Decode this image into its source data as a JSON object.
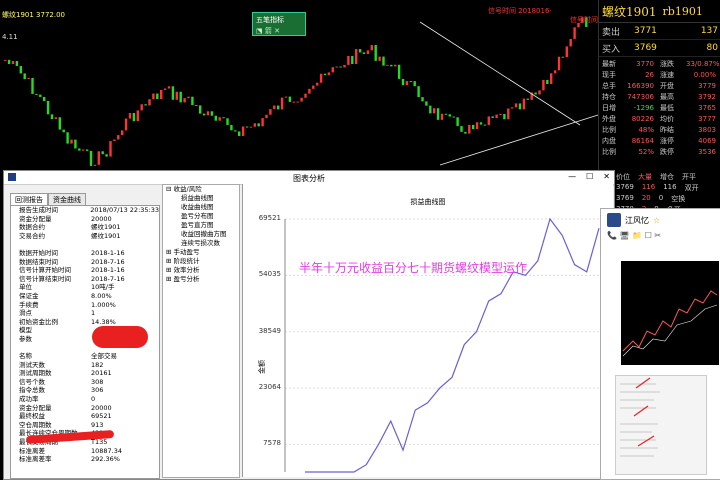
{
  "chart_top": {
    "title": "螺纹1901 3772.00",
    "price_tag": "4.11",
    "hud_title": "五笔指标",
    "hud_icons": "⬔ 箭 ✕",
    "annotation": "信号时间 2018016·",
    "annotation2": "信号时间"
  },
  "quote": {
    "name": "螺纹1901",
    "code": "rb1901",
    "sell_label": "卖出",
    "sell_price": "3771",
    "sell_vol": "137",
    "buy_label": "买入",
    "buy_price": "3769",
    "buy_vol": "80",
    "stats": [
      {
        "k": "最新",
        "v": "3770",
        "k2": "涨跌",
        "v2": "33/0.87%"
      },
      {
        "k": "现手",
        "v": "26",
        "k2": "涨速",
        "v2": "0.00%"
      },
      {
        "k": "总手",
        "v": "166390",
        "k2": "开盘",
        "v2": "3779"
      },
      {
        "k": "持仓",
        "v": "747306",
        "k2": "最高",
        "v2": "3792"
      },
      {
        "k": "日增",
        "v": "-1296",
        "k2": "最低",
        "v2": "3765"
      },
      {
        "k": "外盘",
        "v": "80226",
        "k2": "均价",
        "v2": "3777"
      },
      {
        "k": "比例",
        "v": "48%",
        "k2": "昨结",
        "v2": "3803"
      },
      {
        "k": "内盘",
        "v": "86164",
        "k2": "涨停",
        "v2": "4069"
      },
      {
        "k": "比例",
        "v": "52%",
        "k2": "跌停",
        "v2": "3536"
      }
    ],
    "tick_header": [
      "价位",
      "大量",
      "增仓",
      "开平"
    ],
    "ticks": [
      [
        "3769",
        "116",
        "116",
        "双开"
      ],
      [
        "3769",
        "20",
        "0",
        "空换"
      ],
      [
        "3770",
        "2",
        "0",
        "多开"
      ]
    ]
  },
  "window": {
    "title": "图表分析",
    "controls": [
      "—",
      "☐",
      "✕"
    ],
    "tabs": [
      "回测报告",
      "资金曲线"
    ],
    "report": [
      {
        "k": "报告生成时间",
        "v": "2018/07/13 22:35:33"
      },
      {
        "k": "资金分配量",
        "v": "20000"
      },
      {
        "k": "数据合约",
        "v": "螺纹1901"
      },
      {
        "k": "交易合约",
        "v": "螺纹1901"
      },
      {
        "k": "",
        "v": ""
      },
      {
        "k": "数据开始时间",
        "v": "2018-1-16"
      },
      {
        "k": "数据结束时间",
        "v": "2018-7-16"
      },
      {
        "k": "信号计算开始时间",
        "v": "2018-1-16"
      },
      {
        "k": "信号计算结束时间",
        "v": "2018-7-16"
      },
      {
        "k": "单位",
        "v": "10吨/手"
      },
      {
        "k": "保证金",
        "v": "8.00%"
      },
      {
        "k": "手续费",
        "v": "1.000%"
      },
      {
        "k": "滑点",
        "v": "1"
      },
      {
        "k": "初始资金比例",
        "v": "14.38%"
      },
      {
        "k": "模型",
        "v": ""
      },
      {
        "k": "参数",
        "v": ""
      },
      {
        "k": "",
        "v": ""
      },
      {
        "k": "名称",
        "v": "全部交易"
      },
      {
        "k": "测试天数",
        "v": "182"
      },
      {
        "k": "测试周期数",
        "v": "20161"
      },
      {
        "k": "信号个数",
        "v": "308"
      },
      {
        "k": "指令总数",
        "v": "306"
      },
      {
        "k": "成功率",
        "v": "0"
      },
      {
        "k": "资金分配量",
        "v": "20000"
      },
      {
        "k": "最终权益",
        "v": "69521"
      },
      {
        "k": "空仓周期数",
        "v": "913"
      },
      {
        "k": "最长连续空仓周期数",
        "v": "421"
      },
      {
        "k": "最长交易周期",
        "v": "T135"
      },
      {
        "k": "标准离差",
        "v": "10887.34"
      },
      {
        "k": "标准离差率",
        "v": "292.36%"
      }
    ],
    "tree": [
      {
        "t": "⊟ 收益/风险",
        "lvl": 0
      },
      {
        "t": "损益曲线图",
        "lvl": 1
      },
      {
        "t": "收益曲线图",
        "lvl": 1
      },
      {
        "t": "盈亏分布图",
        "lvl": 1
      },
      {
        "t": "盈亏直方图",
        "lvl": 1
      },
      {
        "t": "收益回撤曲方图",
        "lvl": 1
      },
      {
        "t": "连续亏损次数",
        "lvl": 1
      },
      {
        "t": "⊞ 手动盈亏",
        "lvl": 0
      },
      {
        "t": "⊞ 阶段统计",
        "lvl": 0
      },
      {
        "t": "⊞ 效率分析",
        "lvl": 0
      },
      {
        "t": "⊞ 盈亏分析",
        "lvl": 0
      }
    ],
    "plot_title": "损益曲线图",
    "yaxis_name": "金额",
    "overlay_text": "半年十万元收益百分七十期货螺纹模型运作"
  },
  "chart_data": {
    "type": "line",
    "title": "损益曲线图",
    "ylabel": "金额",
    "yticks": [
      7578,
      23064,
      38549,
      54035,
      69521
    ],
    "ylim": [
      0,
      69521
    ],
    "series": [
      {
        "values": [
          0,
          0,
          0,
          0,
          0,
          2000,
          7578,
          14000,
          6000,
          17000,
          19000,
          23064,
          26000,
          35000,
          38549,
          47000,
          49000,
          55000,
          54035,
          58000,
          69521,
          65000,
          57000,
          55000,
          67000
        ]
      }
    ]
  },
  "chat": {
    "name": "江风忆",
    "star": "☆",
    "tools": "📞 🖥 📁 ☐ ✂"
  }
}
